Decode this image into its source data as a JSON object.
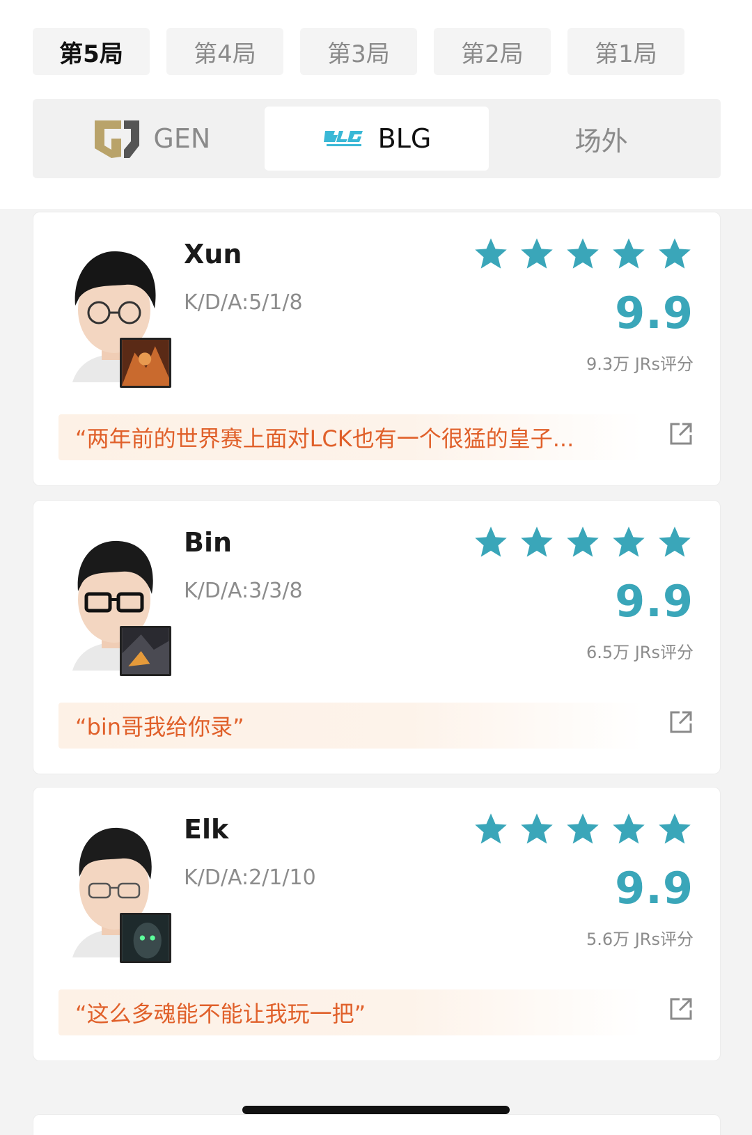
{
  "round_tabs": [
    "第5局",
    "第4局",
    "第3局",
    "第2局",
    "第1局"
  ],
  "active_round": 0,
  "team_tabs": {
    "gen": "GEN",
    "blg": "BLG",
    "offsite": "场外"
  },
  "accent_color": "#3aa6b9",
  "comment_color": "#e0602a",
  "players": [
    {
      "name": "Xun",
      "kda": "K/D/A:5/1/8",
      "rating_stars": 5,
      "score": "9.9",
      "votes": "9.3万 JRs评分",
      "comment": "“两年前的世界赛上面对LCK也有一个很猛的皇子...",
      "champion_icon": "champion-portrait"
    },
    {
      "name": "Bin",
      "kda": "K/D/A:3/3/8",
      "rating_stars": 5,
      "score": "9.9",
      "votes": "6.5万 JRs评分",
      "comment": "“bin哥我给你录”",
      "champion_icon": "champion-portrait"
    },
    {
      "name": "Elk",
      "kda": "K/D/A:2/1/10",
      "rating_stars": 5,
      "score": "9.9",
      "votes": "5.6万 JRs评分",
      "comment": "“这么多魂能不能让我玩一把”",
      "champion_icon": "champion-portrait"
    }
  ]
}
